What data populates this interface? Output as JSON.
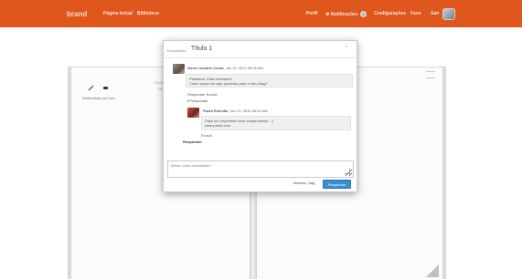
{
  "navbar": {
    "brand": "brand",
    "links": [
      "Página Inicial",
      "Biblioteca"
    ],
    "right_links": [
      "Perfil",
      "Notificações",
      "Configurações",
      "Favs",
      "Sair"
    ],
    "notification_count": "1"
  },
  "book": {
    "left_caption": "Desenvolvido por Livro",
    "faint_title": "Título 1",
    "faint_subtitle": "Título"
  },
  "dialog": {
    "title_prefix": "Discussões",
    "title": "Título 1",
    "close_glyph": "×",
    "comments": [
      {
        "author": "Nome Usuário Conta",
        "date": "Jan 13, 2012 08:05 AM",
        "text_line1": "Parabéns. Está excelente!",
        "text_line2": "Como posso ter algo parecido para o meu blog?",
        "reply_label": "Responder",
        "delete_label": "Excluir",
        "replies_toggle": "Respostas"
      },
      {
        "author": "Paulo Estevão",
        "date": "Jan 13, 2012 08:30 AM",
        "text_line1": "Faça um orçamento sem compromisso. :-)",
        "text_line2": "www.paulo.com",
        "delete_label": "Excluir"
      }
    ],
    "reply_main": "Responder",
    "input_placeholder": "Deixe o seu comentário *",
    "attach_label": "Anexos",
    "img_label": "Img",
    "submit_label": "Responder"
  }
}
